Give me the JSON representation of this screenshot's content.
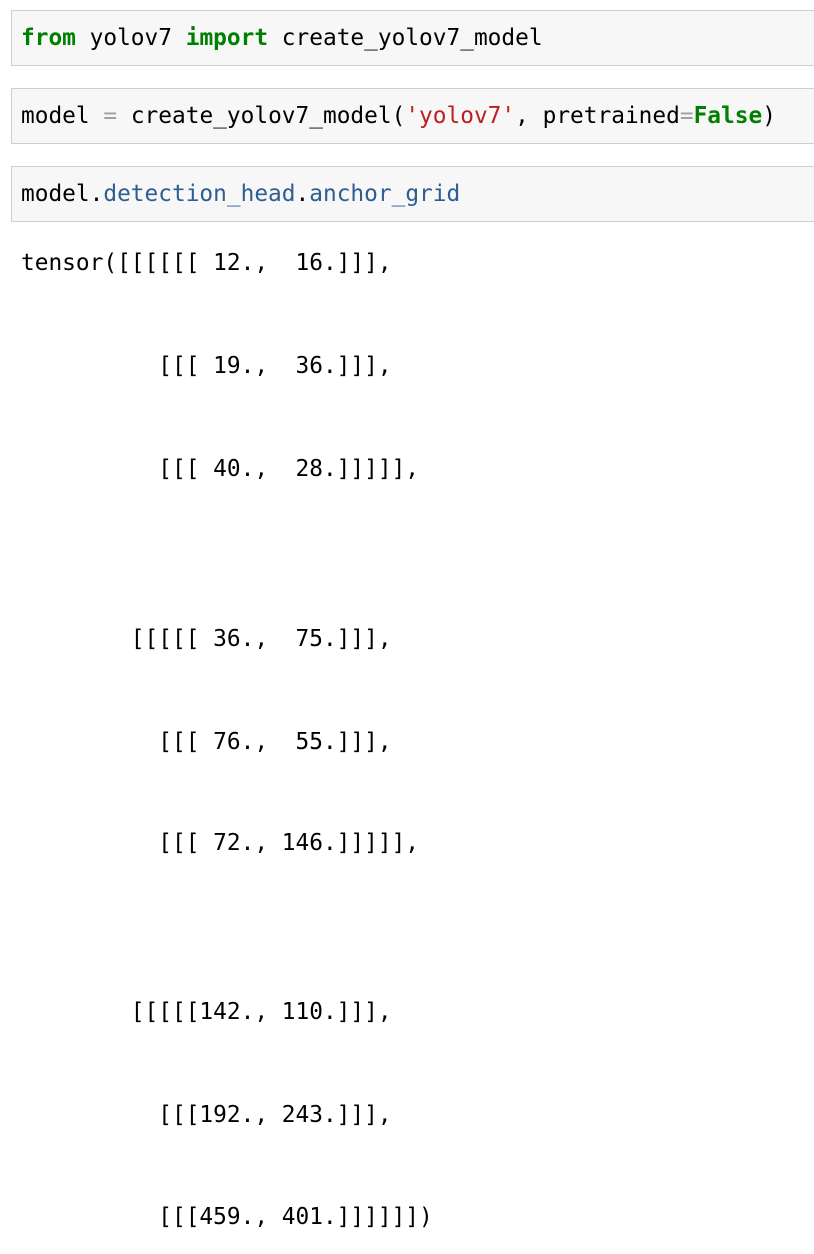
{
  "cells": [
    {
      "parts": [
        {
          "text": "from",
          "style": "kw"
        },
        {
          "text": " yolov7 ",
          "style": ""
        },
        {
          "text": "import",
          "style": "kw"
        },
        {
          "text": " create_yolov7_model",
          "style": ""
        }
      ]
    },
    {
      "parts": [
        {
          "text": "model ",
          "style": ""
        },
        {
          "text": "=",
          "style": "op"
        },
        {
          "text": " create_yolov7_model(",
          "style": ""
        },
        {
          "text": "'yolov7'",
          "style": "str"
        },
        {
          "text": ", pretrained",
          "style": ""
        },
        {
          "text": "=",
          "style": "op"
        },
        {
          "text": "False",
          "style": "kw"
        },
        {
          "text": ")",
          "style": ""
        }
      ]
    },
    {
      "parts": [
        {
          "text": "model",
          "style": ""
        },
        {
          "text": ".",
          "style": ""
        },
        {
          "text": "detection_head",
          "style": "attr"
        },
        {
          "text": ".",
          "style": ""
        },
        {
          "text": "anchor_grid",
          "style": "attr"
        }
      ]
    }
  ],
  "output_lines": [
    "tensor([[[[[[ 12.,  16.]]],",
    "          [[[ 19.,  36.]]],",
    "          [[[ 40.,  28.]]]]],",
    "        [[[[[ 36.,  75.]]],",
    "          [[[ 76.,  55.]]],",
    "          [[[ 72., 146.]]]]],",
    "        [[[[[142., 110.]]],",
    "          [[[192., 243.]]],",
    "          [[[459., 401.]]]]]])"
  ]
}
